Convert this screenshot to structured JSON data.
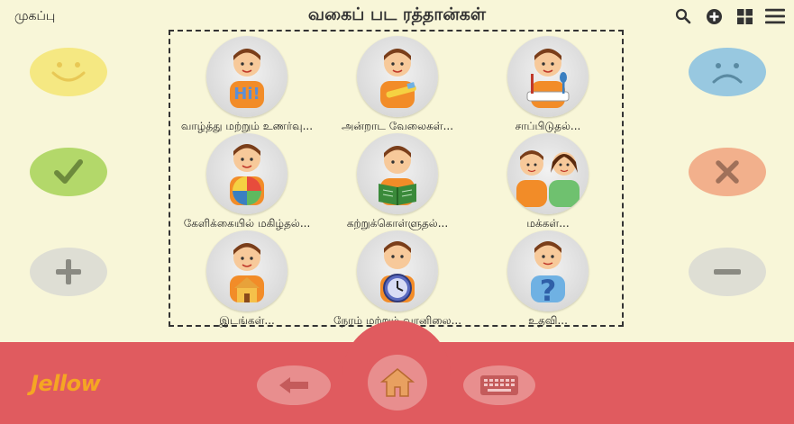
{
  "header": {
    "home_label": "முகப்பு",
    "title": "வகைப் பட ரத்தான்கள்"
  },
  "top_icons": [
    "search-icon",
    "add-icon",
    "grid-icon",
    "menu-icon"
  ],
  "side_buttons": {
    "left": [
      "like-button",
      "yes-button",
      "more-button"
    ],
    "right": [
      "dislike-button",
      "no-button",
      "less-button"
    ]
  },
  "tiles": [
    {
      "label": "வாழ்த்து மற்றும் உணர்வு...",
      "icon": "hi-icon"
    },
    {
      "label": "அன்றாட வேலைகள்...",
      "icon": "toothbrush-icon"
    },
    {
      "label": "சாப்பிடுதல்...",
      "icon": "food-icon"
    },
    {
      "label": "கேளிக்கையில் மகிழ்தல்...",
      "icon": "ball-icon"
    },
    {
      "label": "கற்றுக்கொள்ளுதல்...",
      "icon": "book-icon"
    },
    {
      "label": "மக்கள்...",
      "icon": "people-icon"
    },
    {
      "label": "இடங்கள்...",
      "icon": "house-icon"
    },
    {
      "label": "நேரம் மற்றும் வானிலை...",
      "icon": "clock-icon"
    },
    {
      "label": "உதவி...",
      "icon": "question-icon"
    }
  ],
  "footer": {
    "logo": "Jellow"
  },
  "colors": {
    "background": "#f8f6d8",
    "footer": "#e05b5f",
    "logo": "#f5a623"
  }
}
